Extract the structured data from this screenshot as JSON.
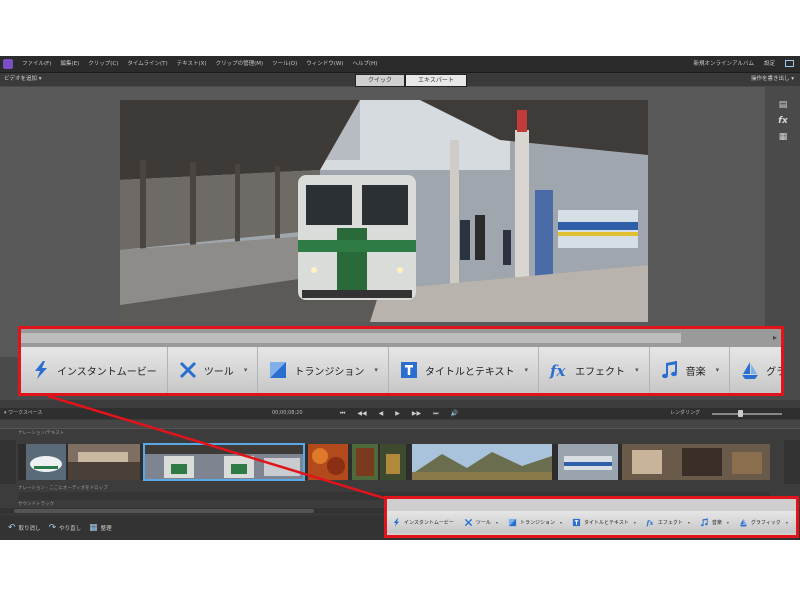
{
  "app": {
    "menus": [
      "ファイル(F)",
      "編集(E)",
      "クリップ(C)",
      "タイムライン(T)",
      "テキスト(X)",
      "クリップの管理(M)",
      "ツール(O)",
      "ウィンドウ(W)",
      "ヘルプ(H)"
    ],
    "menubar_right": [
      "新規オンラインアルバム",
      "設定"
    ],
    "context_left": "ビデオを追加 ▾",
    "context_right": "操作を書き出し ▾",
    "mode_tabs": [
      "クイック",
      "エキスパート"
    ]
  },
  "right_tools": [
    "▤",
    "fx",
    "▦"
  ],
  "transport": {
    "timeline_label": "▾ ワークスペース",
    "timecode": "00;00;08;20",
    "buttons": [
      "⏮",
      "◀◀",
      "◀",
      "▶",
      "▶▶",
      "⏭",
      "🔊"
    ],
    "zoom_label": "レンダリング"
  },
  "tracks": {
    "top_label": "ナレーション/テキスト",
    "under_labels": [
      "ナレーション - ここにオーディオをドロップ",
      "サウンドトラック"
    ]
  },
  "bottom_buttons": [
    {
      "icon": "↶",
      "label": "取り消し"
    },
    {
      "icon": "↷",
      "label": "やり直し"
    },
    {
      "icon": "▦",
      "label": "整理"
    }
  ],
  "action_bar": [
    {
      "icon": "lightning",
      "label": "インスタントムービー"
    },
    {
      "icon": "tools",
      "label": "ツール"
    },
    {
      "icon": "transition",
      "label": "トランジション"
    },
    {
      "icon": "title",
      "label": "タイトルとテキスト"
    },
    {
      "icon": "fx",
      "label": "エフェクト"
    },
    {
      "icon": "music",
      "label": "音楽"
    },
    {
      "icon": "graphics",
      "label": "グラフィック"
    }
  ],
  "action_arrow": "▾",
  "scroll_arrow": "▸",
  "colors": {
    "highlight": "#e0141a",
    "selection": "#5aa9e6",
    "accent_blue": "#2a6fd0"
  }
}
